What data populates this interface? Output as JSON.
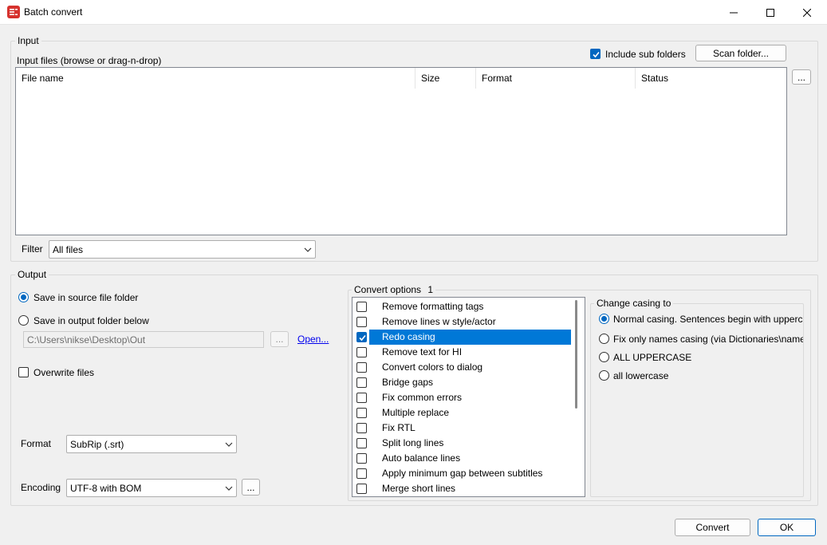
{
  "window": {
    "title": "Batch convert"
  },
  "input": {
    "group_label": "Input",
    "files_label": "Input files (browse or drag-n-drop)",
    "include_subfolders_label": "Include sub folders",
    "include_subfolders_checked": true,
    "scan_folder_label": "Scan folder...",
    "browse_label": "...",
    "columns": [
      "File name",
      "Size",
      "Format",
      "Status"
    ],
    "filter_label": "Filter",
    "filter_value": "All files"
  },
  "output": {
    "group_label": "Output",
    "save_source_label": "Save in source file folder",
    "save_output_label": "Save in output folder below",
    "selected_save_mode": "source",
    "output_folder": "C:\\Users\\nikse\\Desktop\\Out",
    "browse_label": "...",
    "open_label": "Open...",
    "overwrite_label": "Overwrite files",
    "overwrite_checked": false,
    "format_label": "Format",
    "format_value": "SubRip (.srt)",
    "encoding_label": "Encoding",
    "encoding_value": "UTF-8 with BOM",
    "encoding_more_label": "..."
  },
  "convert_options": {
    "group_label": "Convert options",
    "count": "1",
    "items": [
      {
        "label": "Remove formatting tags",
        "checked": false,
        "selected": false
      },
      {
        "label": "Remove lines w style/actor",
        "checked": false,
        "selected": false
      },
      {
        "label": "Redo casing",
        "checked": true,
        "selected": true
      },
      {
        "label": "Remove text for HI",
        "checked": false,
        "selected": false
      },
      {
        "label": "Convert colors to dialog",
        "checked": false,
        "selected": false
      },
      {
        "label": "Bridge gaps",
        "checked": false,
        "selected": false
      },
      {
        "label": "Fix common errors",
        "checked": false,
        "selected": false
      },
      {
        "label": "Multiple replace",
        "checked": false,
        "selected": false
      },
      {
        "label": "Fix RTL",
        "checked": false,
        "selected": false
      },
      {
        "label": "Split long lines",
        "checked": false,
        "selected": false
      },
      {
        "label": "Auto balance lines",
        "checked": false,
        "selected": false
      },
      {
        "label": "Apply minimum gap between subtitles",
        "checked": false,
        "selected": false
      },
      {
        "label": "Merge short lines",
        "checked": false,
        "selected": false
      }
    ]
  },
  "casing": {
    "group_label": "Change casing to",
    "options": [
      {
        "label": "Normal casing. Sentences begin with uppercase letter.",
        "checked": true
      },
      {
        "label": "Fix only names casing (via Dictionaries\\names.xml)",
        "checked": false
      },
      {
        "label": "ALL UPPERCASE",
        "checked": false
      },
      {
        "label": "all lowercase",
        "checked": false
      }
    ]
  },
  "footer": {
    "convert_label": "Convert",
    "ok_label": "OK"
  },
  "colors": {
    "accent": "#0067c0",
    "selection": "#0078d7",
    "app_icon": "#d6322e"
  }
}
